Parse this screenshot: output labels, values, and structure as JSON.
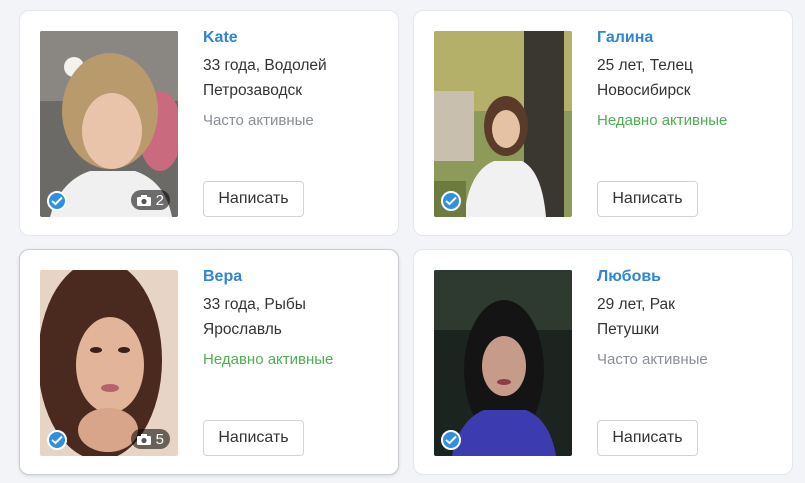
{
  "profiles": [
    {
      "name": "Kate",
      "age_sign": "33 года, Водолей",
      "city": "Петрозаводск",
      "status": "Часто активные",
      "status_color": "#8a8f96",
      "photos": "2",
      "button": "Написать"
    },
    {
      "name": "Галина",
      "age_sign": "25 лет, Телец",
      "city": "Новосибирск",
      "status": "Недавно активные",
      "status_color": "#4caf50",
      "photos": "",
      "button": "Написать"
    },
    {
      "name": "Вера",
      "age_sign": "33 года, Рыбы",
      "city": "Ярославль",
      "status": "Недавно активные",
      "status_color": "#4caf50",
      "photos": "5",
      "button": "Написать"
    },
    {
      "name": "Любовь",
      "age_sign": "29 лет, Рак",
      "city": "Петушки",
      "status": "Часто активные",
      "status_color": "#8a8f96",
      "photos": "",
      "button": "Написать"
    }
  ],
  "icons": {
    "verified": "check-circle-icon",
    "photos": "camera-icon"
  },
  "colors": {
    "name_link": "#2e86d4",
    "verified": "#2f8fe0",
    "active_recent": "#4caf50",
    "active_often": "#8a8f96"
  }
}
